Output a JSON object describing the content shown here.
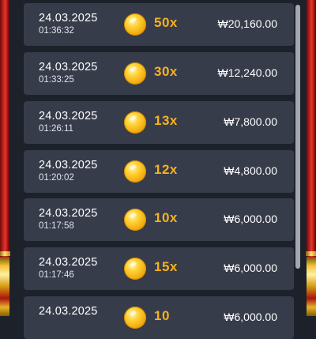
{
  "colors": {
    "background": "#1d212a",
    "row_background": "#373c4b",
    "multiplier": "#f6b21c",
    "pillar_red": "#c5231c",
    "pillar_gold": "#f2c23a"
  },
  "history": [
    {
      "date": "24.03.2025",
      "time": "01:36:32",
      "icon": "gold-coin-icon",
      "multiplier": "50x",
      "amount": "₩20,160.00"
    },
    {
      "date": "24.03.2025",
      "time": "01:33:25",
      "icon": "gold-coin-icon",
      "multiplier": "30x",
      "amount": "₩12,240.00"
    },
    {
      "date": "24.03.2025",
      "time": "01:26:11",
      "icon": "gold-coin-icon",
      "multiplier": "13x",
      "amount": "₩7,800.00"
    },
    {
      "date": "24.03.2025",
      "time": "01:20:02",
      "icon": "gold-coin-icon",
      "multiplier": "12x",
      "amount": "₩4,800.00"
    },
    {
      "date": "24.03.2025",
      "time": "01:17:58",
      "icon": "gold-coin-icon",
      "multiplier": "10x",
      "amount": "₩6,000.00"
    },
    {
      "date": "24.03.2025",
      "time": "01:17:46",
      "icon": "gold-coin-icon",
      "multiplier": "15x",
      "amount": "₩6,000.00"
    },
    {
      "date": "24.03.2025",
      "time": "",
      "icon": "gold-coin-icon",
      "multiplier": "10",
      "amount": "₩6,000.00"
    }
  ]
}
